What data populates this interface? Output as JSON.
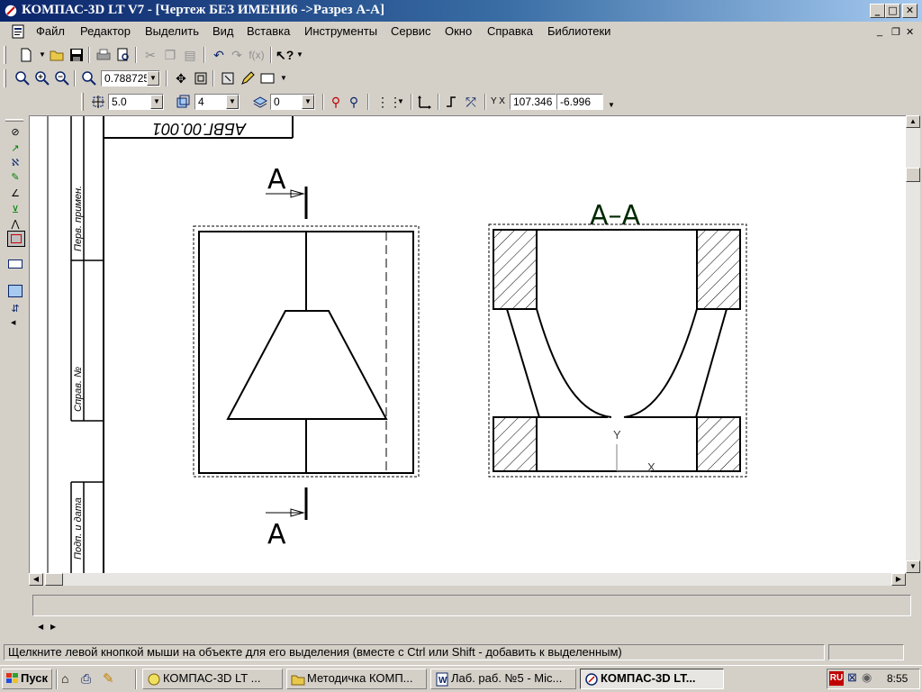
{
  "window": {
    "title": "КОМПАС-3D LT V7 - [Чертеж БЕЗ ИМЕНИ6 ->Разрез А-А]"
  },
  "menu": {
    "items": [
      "Файл",
      "Редактор",
      "Выделить",
      "Вид",
      "Вставка",
      "Инструменты",
      "Сервис",
      "Окно",
      "Справка",
      "Библиотеки"
    ]
  },
  "toolbar_view": {
    "zoom_value": "0.788725"
  },
  "toolbar_current": {
    "step_value": "5.0",
    "layer_value": "4",
    "style_value": "0",
    "x_coord": "107.346",
    "y_coord": "-6.996"
  },
  "drawing": {
    "stamp_text": "АБВГ.00.001",
    "side_labels": [
      "Перв. примен.",
      "Справ. №",
      "Подп. и дата"
    ],
    "section_arrow_label": "А",
    "section_title": "А–А",
    "axis_y": "Y",
    "axis_x": "X"
  },
  "status": {
    "message": "Щелкните левой кнопкой мыши на объекте для его выделения (вместе с Ctrl или Shift - добавить к выделенным)"
  },
  "taskbar": {
    "start_label": "Пуск",
    "tasks": [
      {
        "label": "КОМПАС-3D LT ...",
        "active": false
      },
      {
        "label": "Методичка КОМП...",
        "active": false
      },
      {
        "label": "Лаб. раб. №5 - Mic...",
        "active": false
      },
      {
        "label": "КОМПАС-3D LT...",
        "active": true
      }
    ],
    "lang": "RU",
    "clock": "8:55"
  }
}
